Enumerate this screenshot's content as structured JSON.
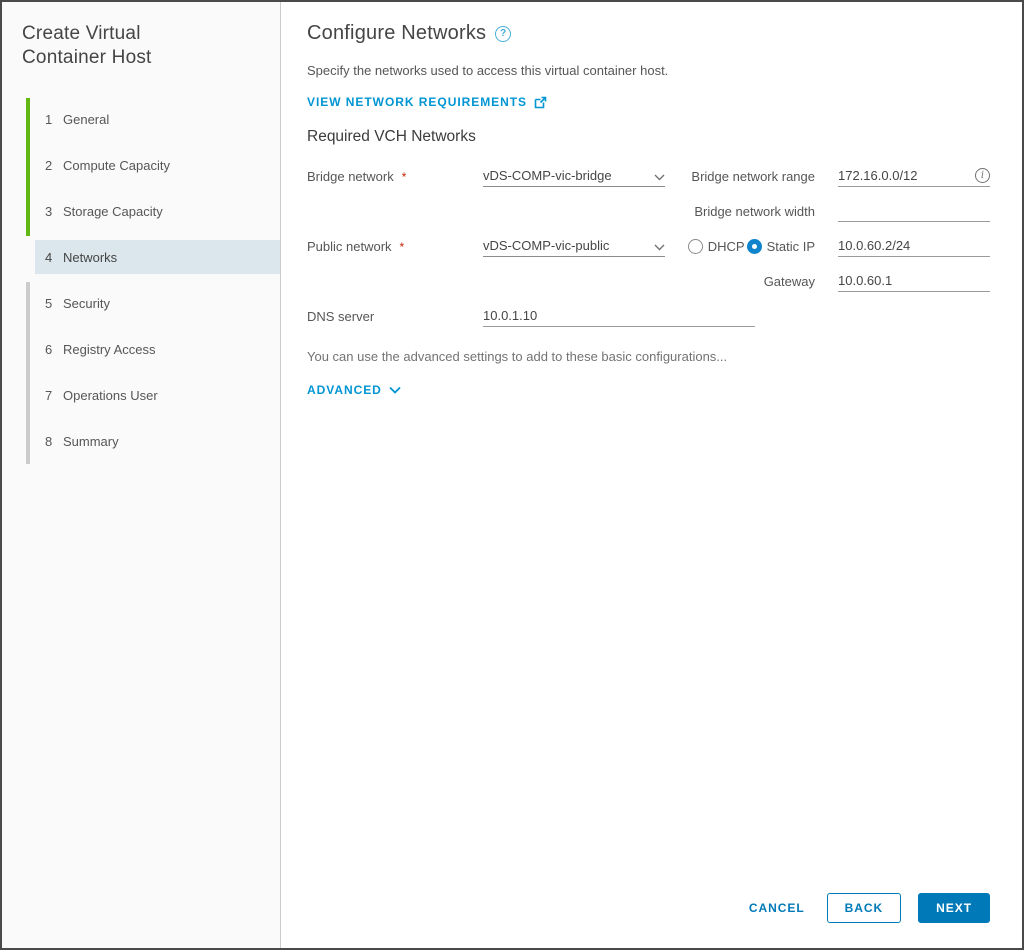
{
  "wizard": {
    "title": "Create Virtual Container Host",
    "steps": [
      {
        "number": "1",
        "label": "General",
        "state": "complete"
      },
      {
        "number": "2",
        "label": "Compute Capacity",
        "state": "complete"
      },
      {
        "number": "3",
        "label": "Storage Capacity",
        "state": "complete"
      },
      {
        "number": "4",
        "label": "Networks",
        "state": "active"
      },
      {
        "number": "5",
        "label": "Security",
        "state": "upcoming"
      },
      {
        "number": "6",
        "label": "Registry Access",
        "state": "upcoming"
      },
      {
        "number": "7",
        "label": "Operations User",
        "state": "upcoming"
      },
      {
        "number": "8",
        "label": "Summary",
        "state": "upcoming"
      }
    ]
  },
  "main": {
    "heading": "Configure Networks",
    "subtitle": "Specify the networks used to access this virtual container host.",
    "requirements_link": "VIEW NETWORK REQUIREMENTS",
    "section_heading": "Required VCH Networks",
    "required_marker": "*",
    "fields": {
      "bridge_network": {
        "label": "Bridge network",
        "required": true,
        "value": "vDS-COMP-vic-bridge"
      },
      "bridge_network_range": {
        "label": "Bridge network range",
        "value": "172.16.0.0/12"
      },
      "bridge_network_width": {
        "label": "Bridge network width",
        "value": ""
      },
      "public_network": {
        "label": "Public network",
        "required": true,
        "value": "vDS-COMP-vic-public"
      },
      "ip_mode": {
        "options": [
          {
            "label": "DHCP",
            "selected": false
          },
          {
            "label": "Static IP",
            "selected": true
          }
        ],
        "static_ip_value": "10.0.60.2/24"
      },
      "gateway": {
        "label": "Gateway",
        "value": "10.0.60.1"
      },
      "dns_server": {
        "label": "DNS server",
        "value": "10.0.1.10"
      }
    },
    "advanced_hint": "You can use the advanced settings to add to these basic configurations...",
    "advanced_label": "ADVANCED"
  },
  "footer": {
    "cancel_label": "CANCEL",
    "back_label": "BACK",
    "next_label": "NEXT"
  },
  "icons": {
    "help": "?",
    "info": "i",
    "external_link": "external-link-icon",
    "chevron_down": "chevron-down-icon"
  },
  "colors": {
    "accent_button": "#0079b8",
    "accent_link": "#0095d3",
    "radio_selected": "#0f84cc",
    "step_complete_bar": "#62b715",
    "step_upcoming_bar": "#cccccc",
    "active_step_bg": "#dce6ed",
    "required_marker": "#c92100",
    "help_icon": "#49afd9"
  }
}
